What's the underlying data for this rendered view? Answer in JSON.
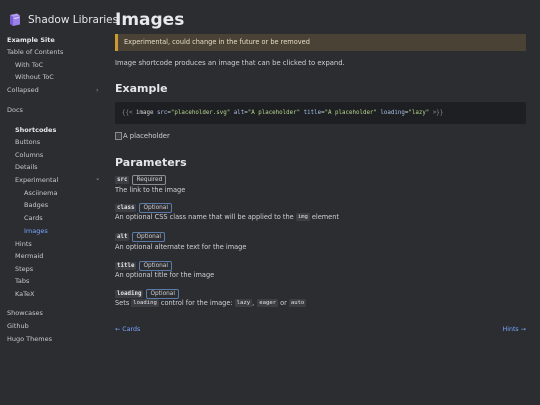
{
  "brand": {
    "title": "Shadow Libraries",
    "icon": "book-icon"
  },
  "sidebar": {
    "items": [
      {
        "label": "Example Site",
        "style": "bold"
      },
      {
        "label": "Table of Contents"
      },
      {
        "label": "With ToC"
      },
      {
        "label": "Without ToC"
      },
      {
        "label": "Collapsed",
        "chevron": "›"
      },
      {
        "label": "Docs"
      },
      {
        "label": "Shortcodes",
        "style": "bold"
      },
      {
        "label": "Buttons"
      },
      {
        "label": "Columns"
      },
      {
        "label": "Details"
      },
      {
        "label": "Experimental",
        "chevron": "⌄"
      },
      {
        "label": "Asciinema"
      },
      {
        "label": "Badges"
      },
      {
        "label": "Cards"
      },
      {
        "label": "Images",
        "active": true
      },
      {
        "label": "Hints"
      },
      {
        "label": "Mermaid"
      },
      {
        "label": "Steps"
      },
      {
        "label": "Tabs"
      },
      {
        "label": "KaTeX"
      },
      {
        "label": "Showcases"
      },
      {
        "label": "Github"
      },
      {
        "label": "Hugo Themes"
      }
    ]
  },
  "main": {
    "title": "Images",
    "hint": "Experimental, could change in the future or be removed",
    "intro": "Image shortcode produces an image that can be clicked to expand.",
    "example_heading": "Example",
    "code": {
      "open": "{{<",
      "name": "image",
      "attrs": [
        {
          "key": "src",
          "value": "\"placeholder.svg\""
        },
        {
          "key": "alt",
          "value": "\"A placeholder\""
        },
        {
          "key": "title",
          "value": "\"A placeholder\""
        },
        {
          "key": "loading",
          "value": "\"lazy\""
        }
      ],
      "close": ">}}"
    },
    "image_alt": "A placeholder",
    "params_heading": "Parameters",
    "params": [
      {
        "name": "src",
        "badge": "Required",
        "desc": "The link to the image"
      },
      {
        "name": "class",
        "badge": "Optional",
        "desc_pre": "An optional CSS class name that will be applied to the",
        "desc_code": "img",
        "desc_post": "element"
      },
      {
        "name": "alt",
        "badge": "Optional",
        "desc": "An optional alternate text for the image"
      },
      {
        "name": "title",
        "badge": "Optional",
        "desc": "An optional title for the image"
      },
      {
        "name": "loading",
        "badge": "Optional",
        "desc_pre": "Sets",
        "desc_code": "loading",
        "desc_mid": "control for the image:",
        "opt1": "lazy",
        "sep1": ",",
        "opt2": "eager",
        "sep2": "or",
        "opt3": "auto"
      }
    ],
    "prev": {
      "arrow": "←",
      "label": "Cards"
    },
    "next": {
      "label": "Hints",
      "arrow": "→"
    }
  },
  "colors": {
    "background": "#2b2d31",
    "accent": "#7aa5ff",
    "hint_border": "#cc9a2e"
  }
}
